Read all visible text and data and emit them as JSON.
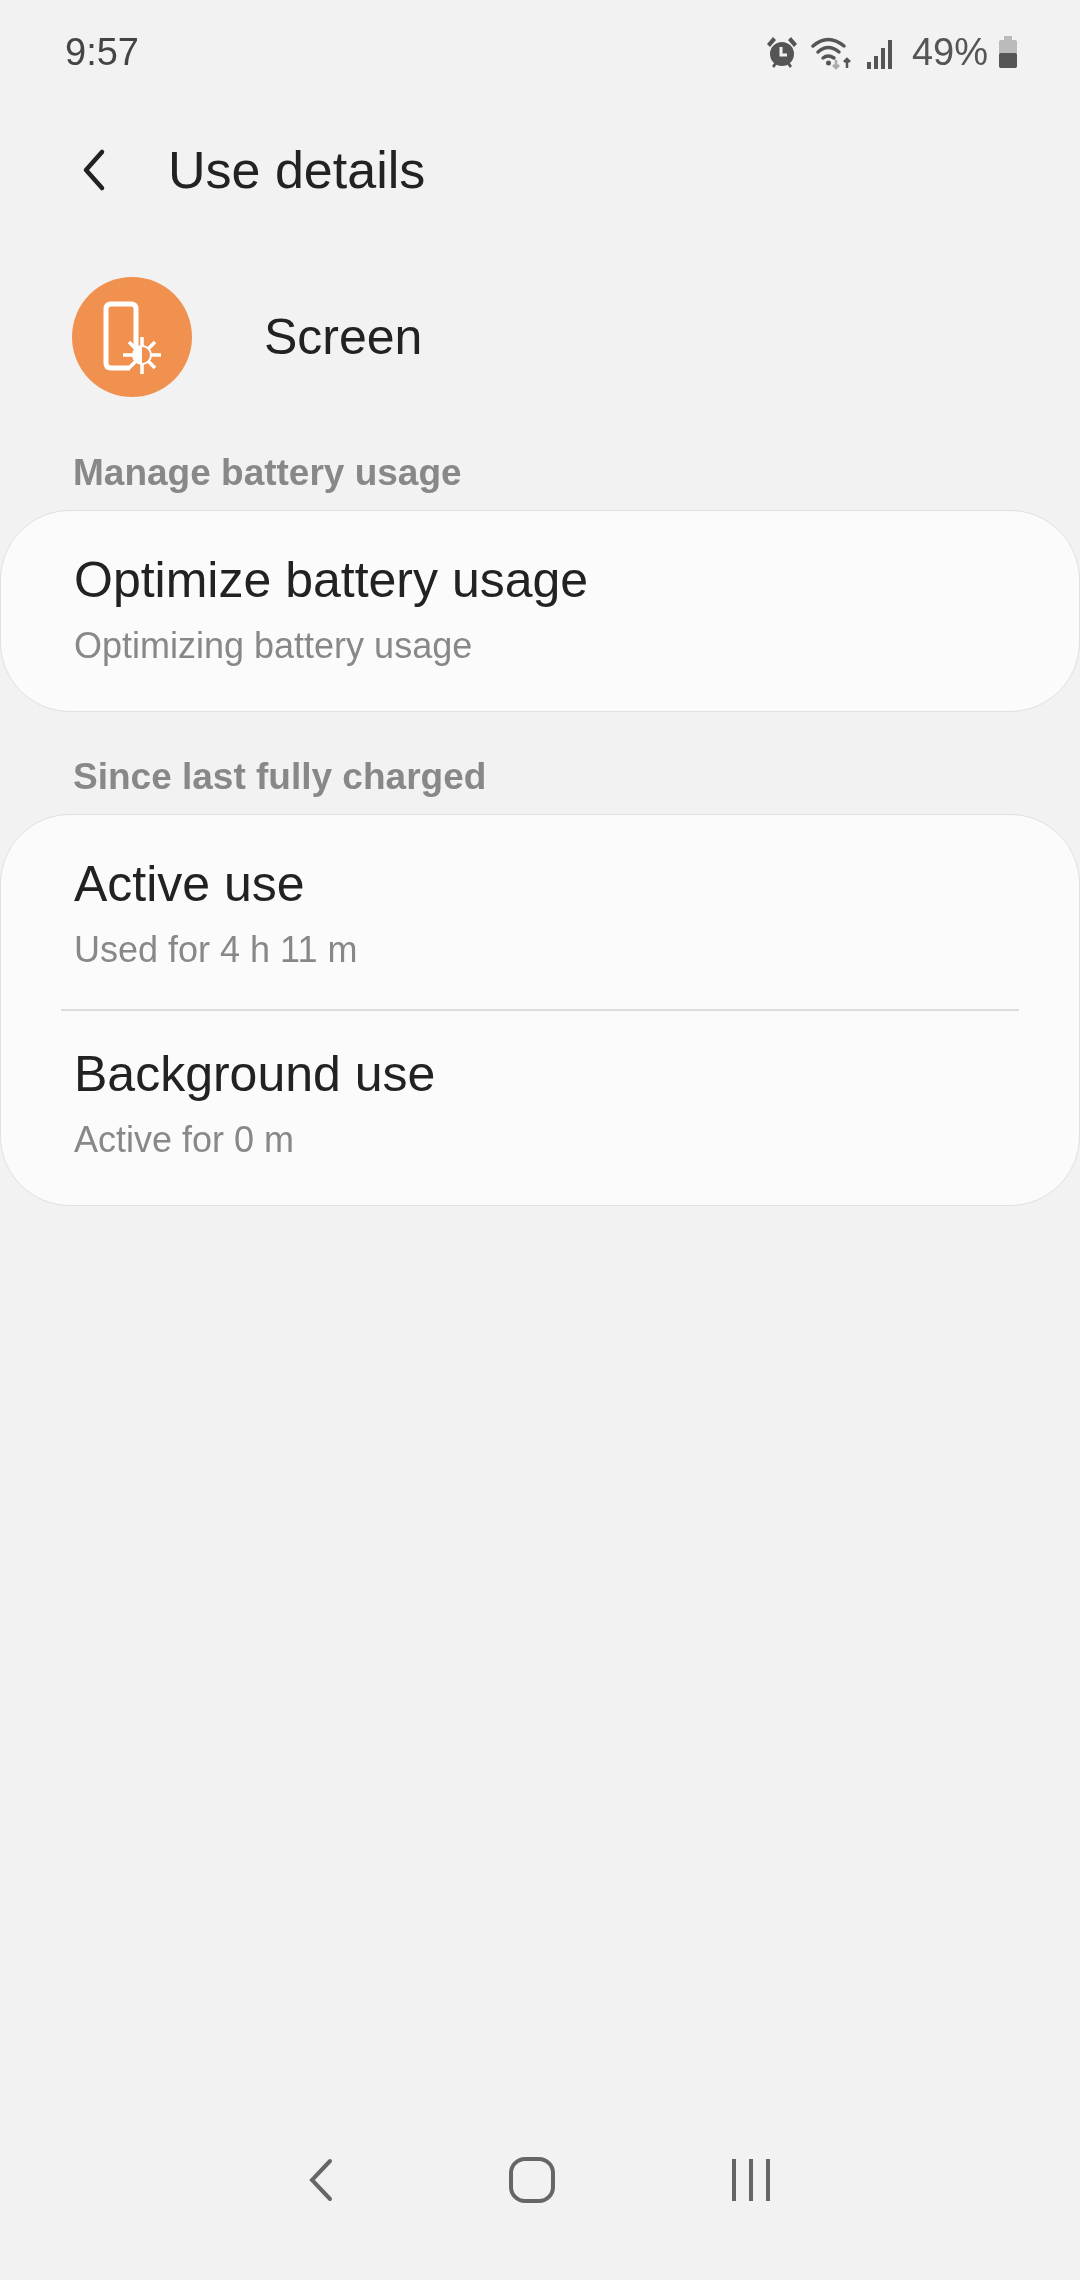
{
  "status_bar": {
    "time": "9:57",
    "battery_percent": "49%"
  },
  "header": {
    "title": "Use details"
  },
  "app": {
    "name": "Screen"
  },
  "sections": [
    {
      "heading": "Manage battery usage",
      "items": [
        {
          "title": "Optimize battery usage",
          "subtitle": "Optimizing battery usage"
        }
      ]
    },
    {
      "heading": "Since last fully charged",
      "items": [
        {
          "title": "Active use",
          "subtitle": "Used for 4 h 11 m"
        },
        {
          "title": "Background use",
          "subtitle": "Active for 0 m"
        }
      ]
    }
  ]
}
